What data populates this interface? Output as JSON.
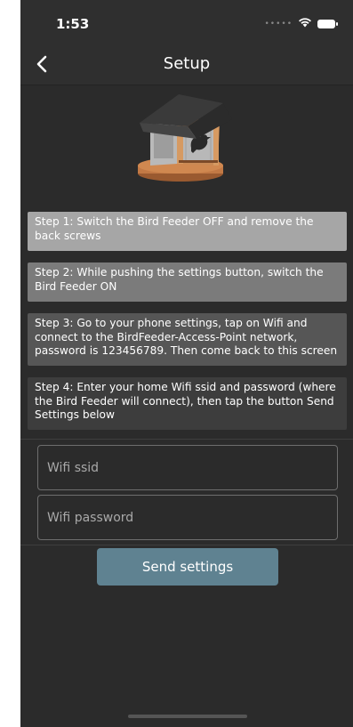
{
  "status_bar": {
    "time": "1:53",
    "signal_icon": "signal-dots-icon",
    "wifi_icon": "wifi-icon",
    "battery_icon": "battery-icon"
  },
  "nav": {
    "back_icon": "chevron-left-icon",
    "title": "Setup"
  },
  "illustration": {
    "icon": "bird-feeder-image"
  },
  "steps": [
    "Step 1: Switch the Bird Feeder OFF and remove the back screws",
    "Step 2: While pushing the settings button, switch the Bird Feeder ON",
    "Step 3: Go to your phone settings, tap on Wifi and connect to the BirdFeeder-Access-Point network, password is 123456789. Then come back to this screen",
    "Step 4: Enter your home Wifi ssid and password (where the Bird Feeder will connect), then tap the button Send Settings below"
  ],
  "form": {
    "ssid_placeholder": "Wifi ssid",
    "ssid_value": "",
    "password_placeholder": "Wifi password",
    "password_value": ""
  },
  "send_button_label": "Send settings",
  "colors": {
    "background": "#2b2b2b",
    "step1": "#a6a6a6",
    "step2": "#7b7b7b",
    "step3": "#565656",
    "step4": "#3d3d3d",
    "button": "#5f8291"
  }
}
